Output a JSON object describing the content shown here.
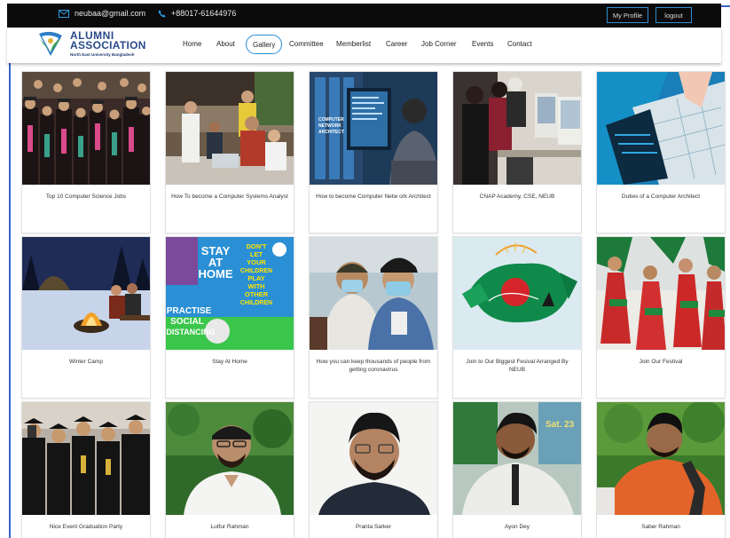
{
  "topbar": {
    "email": "neubaa@gmail.com",
    "phone": "+88017-61644976",
    "my_profile_label": "My Profile",
    "logout_label": "logout"
  },
  "logo": {
    "title_line1": "ALUMNI",
    "title_line2": "ASSOCIATION",
    "subtitle": "North East University Bangladesh"
  },
  "nav": {
    "items": [
      "Home",
      "About",
      "Gallery",
      "Committee",
      "Memberlist",
      "Career",
      "Job Corner",
      "Events",
      "Contact"
    ],
    "active": "Gallery"
  },
  "gallery": [
    {
      "caption": "Top 10 Computer Science Jobs",
      "image": "graduates-crowd-photo"
    },
    {
      "caption": "How To become a Computer Systems Analyst",
      "image": "office-team-photo"
    },
    {
      "caption": "How to become Computer Netw ork Architect",
      "image": "network-architect-photo"
    },
    {
      "caption": "CNAP Academy, CSE, NEUB",
      "image": "computer-lab-photo"
    },
    {
      "caption": "Duties of a Computer Architect",
      "image": "blueprint-laptop-photo"
    },
    {
      "caption": "Winter Camp",
      "image": "winter-campfire-photo"
    },
    {
      "caption": "Stay At Home",
      "image": "stay-at-home-poster",
      "poster_text": [
        "STAY",
        "AT",
        "HOME",
        "DON'T",
        "LET",
        "YOUR",
        "CHILDREN",
        "PLAY",
        "WITH",
        "OTHER",
        "CHILDREN",
        "PRACTISE",
        "SOCIAL",
        "DISTANCING"
      ]
    },
    {
      "caption": "How you can keep thousands of people from getting coronavirus",
      "image": "masked-people-photo"
    },
    {
      "caption": "Join to Our Biggest Fesival Arranged By NEUB",
      "image": "bangladesh-flag-art"
    },
    {
      "caption": "Join Our Festival",
      "image": "festival-dancers-photo"
    },
    {
      "caption": "Nice Event Graduation Party",
      "image": "graduation-selfie-photo"
    },
    {
      "caption": "Lutfur Rahman",
      "image": "portrait-photo"
    },
    {
      "caption": "Pranta Sarker",
      "image": "portrait-photo"
    },
    {
      "caption": "Ayon Dey",
      "image": "portrait-photo",
      "image_text": "Sat. 23"
    },
    {
      "caption": "Saber Rahman",
      "image": "portrait-photo"
    }
  ],
  "colors": {
    "topbar_bg": "#0b0b0b",
    "accent_blue": "#2a8bd0",
    "frame_blue": "#3b63c9"
  }
}
